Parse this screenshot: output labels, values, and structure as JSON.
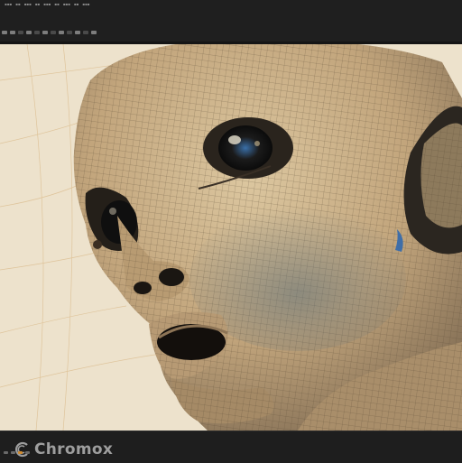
{
  "app": {
    "brand_name": "Chromox",
    "brand_logo_icon": "chromox-logo-icon"
  },
  "colors": {
    "chrome_bg": "#1f1f1f",
    "viewport_bg": "#ede2cc",
    "mesh_skin": "#c8b08a",
    "accent": "#d08a2e"
  },
  "toolbar": {
    "tool_icons": [
      "select-icon",
      "move-icon",
      "rotate-icon",
      "scale-icon",
      "mesh-icon",
      "wireframe-icon",
      "smooth-icon",
      "render-icon"
    ]
  },
  "viewport": {
    "subject": "alien-head-wireframe-model"
  }
}
